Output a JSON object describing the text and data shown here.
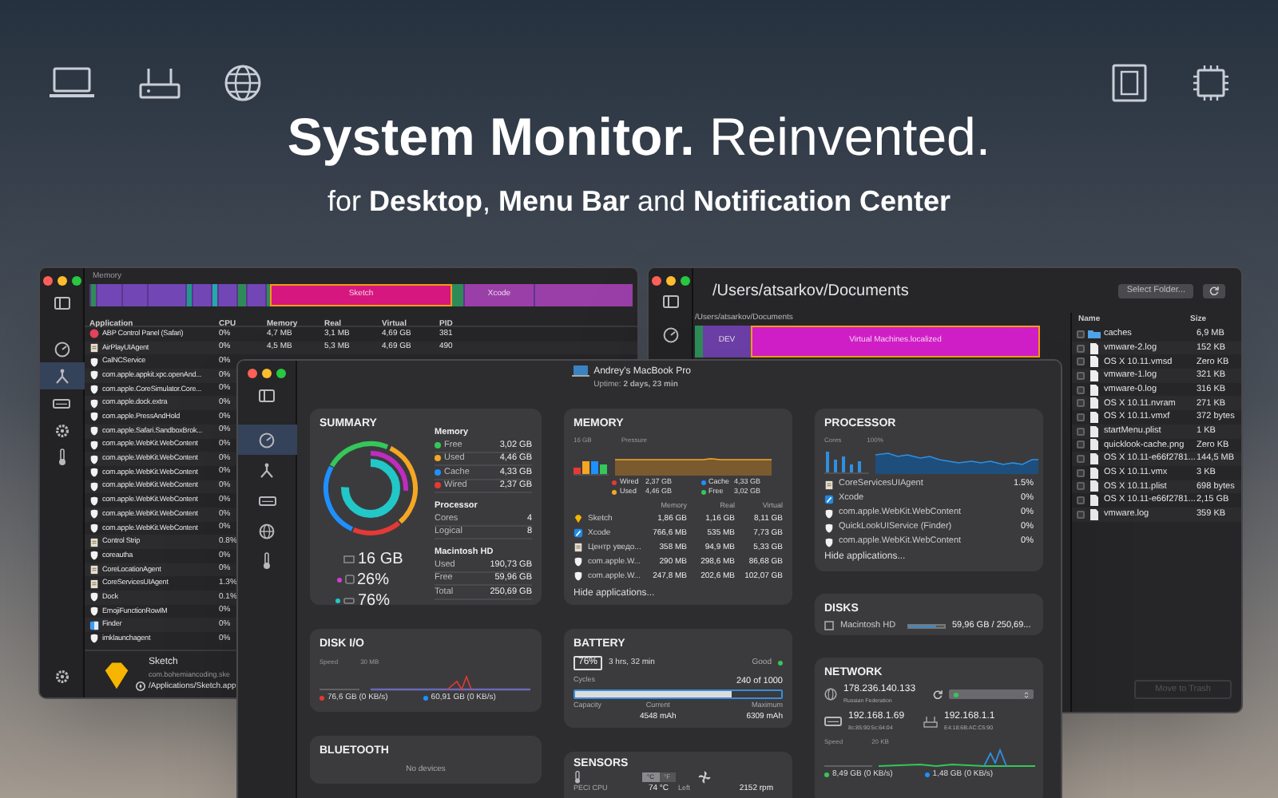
{
  "headline": "**System Monitor.** Reinvented.",
  "subheadline": "for **Desktop**, **Menu Bar** and **Notification Center**",
  "processes_window": {
    "section_label": "Memory",
    "treemap_blocks": [
      {
        "label": "Sketch",
        "selected": true
      },
      {
        "label": "Xcode",
        "selected": false
      }
    ],
    "sidebar_items": [
      {
        "kind": "gauge",
        "selected": false
      },
      {
        "kind": "fork",
        "selected": true
      },
      {
        "kind": "drive",
        "selected": false
      },
      {
        "kind": "gear",
        "selected": false
      },
      {
        "kind": "thermometer",
        "selected": false
      }
    ],
    "columns": [
      "Application",
      "CPU",
      "Memory",
      "Real",
      "Virtual",
      "PID"
    ],
    "rows": [
      {
        "name": "ABP Control Panel (Safari)",
        "cpu": "0%",
        "memory": "4,7 MB",
        "real": "3,1 MB",
        "virtual": "4,69 GB",
        "pid": "381",
        "kind": "stop"
      },
      {
        "name": "AirPlayUIAgent",
        "cpu": "0%",
        "memory": "4,5 MB",
        "real": "5,3 MB",
        "virtual": "4,69 GB",
        "pid": "490",
        "kind": "document"
      },
      {
        "name": "CalNCService",
        "cpu": "0%",
        "kind": "generic"
      },
      {
        "name": "com.apple.appkit.xpc.openAnd...",
        "cpu": "0%",
        "kind": "generic"
      },
      {
        "name": "com.apple.CoreSimulator.Core...",
        "cpu": "0%",
        "kind": "generic"
      },
      {
        "name": "com.apple.dock.extra",
        "cpu": "0%",
        "kind": "generic"
      },
      {
        "name": "com.apple.PressAndHold",
        "cpu": "0%",
        "kind": "generic"
      },
      {
        "name": "com.apple.Safari.SandboxBrok...",
        "cpu": "0%",
        "kind": "generic"
      },
      {
        "name": "com.apple.WebKit.WebContent",
        "cpu": "0%",
        "kind": "generic"
      },
      {
        "name": "com.apple.WebKit.WebContent",
        "cpu": "0%",
        "kind": "generic"
      },
      {
        "name": "com.apple.WebKit.WebContent",
        "cpu": "0%",
        "kind": "generic"
      },
      {
        "name": "com.apple.WebKit.WebContent",
        "cpu": "0%",
        "kind": "generic"
      },
      {
        "name": "com.apple.WebKit.WebContent",
        "cpu": "0%",
        "kind": "generic"
      },
      {
        "name": "com.apple.WebKit.WebContent",
        "cpu": "0%",
        "kind": "generic"
      },
      {
        "name": "com.apple.WebKit.WebContent",
        "cpu": "0%",
        "kind": "generic"
      },
      {
        "name": "Control Strip",
        "cpu": "0.8%",
        "kind": "document"
      },
      {
        "name": "coreautha",
        "cpu": "0%",
        "kind": "generic"
      },
      {
        "name": "CoreLocationAgent",
        "cpu": "0%",
        "kind": "document"
      },
      {
        "name": "CoreServicesUIAgent",
        "cpu": "1.3%",
        "kind": "document"
      },
      {
        "name": "Dock",
        "cpu": "0.1%",
        "kind": "generic"
      },
      {
        "name": "EmojiFunctionRowIM",
        "cpu": "0%",
        "kind": "generic"
      },
      {
        "name": "Finder",
        "cpu": "0%",
        "kind": "finder"
      },
      {
        "name": "imklaunchagent",
        "cpu": "0%",
        "kind": "generic"
      }
    ],
    "selected_app": {
      "name": "Sketch",
      "bundle_id": "com.bohemiancoding.ske",
      "path": "/Applications/Sketch.app"
    }
  },
  "files_window": {
    "title": "/Users/atsarkov/Documents",
    "select_folder_button": "Select Folder...",
    "treemap_path": "/Users/atsarkov/Documents",
    "treemap_blocks": [
      {
        "label": "DEV",
        "selected": false
      },
      {
        "label": "Virtual Machines.localized",
        "selected": true
      }
    ],
    "columns": [
      "Name",
      "Size"
    ],
    "files": [
      {
        "name": "caches",
        "size": "6,9 MB",
        "kind": "folder",
        "checked": false
      },
      {
        "name": "vmware-2.log",
        "size": "152 KB",
        "kind": "file",
        "checked": false
      },
      {
        "name": "OS X 10.11.vmsd",
        "size": "Zero KB",
        "kind": "file",
        "checked": false
      },
      {
        "name": "vmware-1.log",
        "size": "321 KB",
        "kind": "file",
        "checked": false
      },
      {
        "name": "vmware-0.log",
        "size": "316 KB",
        "kind": "file",
        "checked": false
      },
      {
        "name": "OS X 10.11.nvram",
        "size": "271 KB",
        "kind": "file",
        "checked": false
      },
      {
        "name": "OS X 10.11.vmxf",
        "size": "372 bytes",
        "kind": "file",
        "checked": false
      },
      {
        "name": "startMenu.plist",
        "size": "1 KB",
        "kind": "file",
        "checked": false
      },
      {
        "name": "quicklook-cache.png",
        "size": "Zero KB",
        "kind": "file",
        "checked": false
      },
      {
        "name": "OS X 10.11-e66f2781...",
        "size": "144,5 MB",
        "kind": "file",
        "checked": false
      },
      {
        "name": "OS X 10.11.vmx",
        "size": "3 KB",
        "kind": "file",
        "checked": false
      },
      {
        "name": "OS X 10.11.plist",
        "size": "698 bytes",
        "kind": "file",
        "checked": false
      },
      {
        "name": "OS X 10.11-e66f2781...",
        "size": "2,15 GB",
        "kind": "file",
        "checked": false
      },
      {
        "name": "vmware.log",
        "size": "359 KB",
        "kind": "file",
        "checked": false
      }
    ],
    "trash_button": {
      "label": "Move to Trash",
      "disabled": true
    }
  },
  "dashboard_window": {
    "device": "Andrey's MacBook Pro",
    "uptime": "Uptime: **2 days, 23 min**",
    "sidebar_items": [
      {
        "kind": "gauge",
        "selected": true
      },
      {
        "kind": "fork",
        "selected": false
      },
      {
        "kind": "drive",
        "selected": false
      },
      {
        "kind": "globe",
        "selected": false
      },
      {
        "kind": "thermometer",
        "selected": false
      }
    ],
    "summary": {
      "title": "SUMMARY",
      "stats": [
        {
          "value": "16 GB",
          "kind": "memory"
        },
        {
          "value": "26%",
          "kind": "cpu",
          "color": "#d63ad6"
        },
        {
          "value": "76%",
          "kind": "disk",
          "color": "#22c7c7"
        }
      ],
      "sections": [
        {
          "title": "Memory",
          "items": [
            {
              "label": "Free",
              "value": "3,02 GB",
              "color": "#34c759"
            },
            {
              "label": "Used",
              "value": "4,46 GB",
              "color": "#f5a623"
            },
            {
              "label": "Cache",
              "value": "4,33 GB",
              "color": "#1e90ff"
            },
            {
              "label": "Wired",
              "value": "2,37 GB",
              "color": "#e53935"
            }
          ]
        },
        {
          "title": "Processor",
          "items": [
            {
              "label": "Cores",
              "value": "4"
            },
            {
              "label": "Logical",
              "value": "8"
            }
          ]
        },
        {
          "title": "Macintosh HD",
          "items": [
            {
              "label": "Used",
              "value": "190,73 GB"
            },
            {
              "label": "Free",
              "value": "59,96 GB"
            },
            {
              "label": "Total",
              "value": "250,69 GB"
            }
          ]
        }
      ]
    },
    "disk_io": {
      "title": "DISK I/O",
      "speed_label": "Speed",
      "scale_label": "30 MB",
      "legend": [
        {
          "value": "76,6 GB (0 KB/s)",
          "color": "#e53935"
        },
        {
          "value": "60,91 GB (0 KB/s)",
          "color": "#1e90ff"
        }
      ]
    },
    "bluetooth": {
      "title": "BLUETOOTH",
      "empty_text": "No devices"
    },
    "memory": {
      "title": "MEMORY",
      "total_label": "16 GB",
      "pressure_label": "Pressure",
      "legend": [
        {
          "label": "Wired",
          "value": "2,37 GB",
          "color": "#e53935"
        },
        {
          "label": "Cache",
          "value": "4,33 GB",
          "color": "#1e90ff"
        },
        {
          "label": "Used",
          "value": "4,46 GB",
          "color": "#f5a623"
        },
        {
          "label": "Free",
          "value": "3,02 GB",
          "color": "#34c759"
        }
      ],
      "columns": [
        "Memory",
        "Real",
        "Virtual"
      ],
      "apps": [
        {
          "name": "Sketch",
          "memory": "1,86 GB",
          "real": "1,16 GB",
          "virtual": "8,11 GB",
          "kind": "sketch"
        },
        {
          "name": "Xcode",
          "memory": "766,6 MB",
          "real": "535 MB",
          "virtual": "7,73 GB",
          "kind": "xcode"
        },
        {
          "name": "Центр уведо...",
          "memory": "358 MB",
          "real": "94,9 MB",
          "virtual": "5,33 GB",
          "kind": "document"
        },
        {
          "name": "com.apple.W...",
          "memory": "290 MB",
          "real": "298,6 MB",
          "virtual": "86,68 GB",
          "kind": "generic"
        },
        {
          "name": "com.apple.W...",
          "memory": "247,8 MB",
          "real": "202,6 MB",
          "virtual": "102,07 GB",
          "kind": "generic"
        }
      ],
      "hide_link": "Hide applications..."
    },
    "battery": {
      "title": "BATTERY",
      "percent": "76%",
      "time_left": "3 hrs, 32 min",
      "health": "Good",
      "cycles_label": "Cycles",
      "cycles": "240 of 1000",
      "level": 0.76,
      "capacity_label": "Capacity",
      "current_label": "Current",
      "current": "4548 mAh",
      "maximum_label": "Maximum",
      "maximum": "6309 mAh"
    },
    "sensors": {
      "title": "SENSORS",
      "units": [
        {
          "label": "°C",
          "selected": true
        },
        {
          "label": "°F",
          "selected": false
        }
      ],
      "readings": [
        {
          "label": "PECI CPU",
          "value": "74 °C"
        },
        {
          "label": "Left",
          "value": "2152 rpm"
        }
      ]
    },
    "processor": {
      "title": "PROCESSOR",
      "cores_label": "Cores",
      "scale_label": "100%",
      "apps": [
        {
          "name": "CoreServicesUIAgent",
          "cpu": "1.5%",
          "kind": "document"
        },
        {
          "name": "Xcode",
          "cpu": "0%",
          "kind": "xcode"
        },
        {
          "name": "com.apple.WebKit.WebContent",
          "cpu": "0%",
          "kind": "generic"
        },
        {
          "name": "QuickLookUIService (Finder)",
          "cpu": "0%",
          "kind": "generic"
        },
        {
          "name": "com.apple.WebKit.WebContent",
          "cpu": "0%",
          "kind": "generic"
        }
      ],
      "hide_link": "Hide applications..."
    },
    "disks": {
      "title": "DISKS",
      "items": [
        {
          "name": "Macintosh HD",
          "level": 0.76,
          "value": "59,96 GB / 250,69..."
        }
      ]
    },
    "network": {
      "title": "NETWORK",
      "public_ip": "178.236.140.133",
      "country": "Russian Federation",
      "local_ip": "192.168.1.69",
      "local_mac": "8c:85:90:5c:64:04",
      "router_ip": "192.168.1.1",
      "router_mac": "E4:18:6B:AC:C5:90",
      "speed_label": "Speed",
      "scale_label": "20 KB",
      "legend": [
        {
          "value": "8,49 GB (0 KB/s)",
          "color": "#34c759"
        },
        {
          "value": "1,48 GB (0 KB/s)",
          "color": "#1e90ff"
        }
      ]
    }
  }
}
